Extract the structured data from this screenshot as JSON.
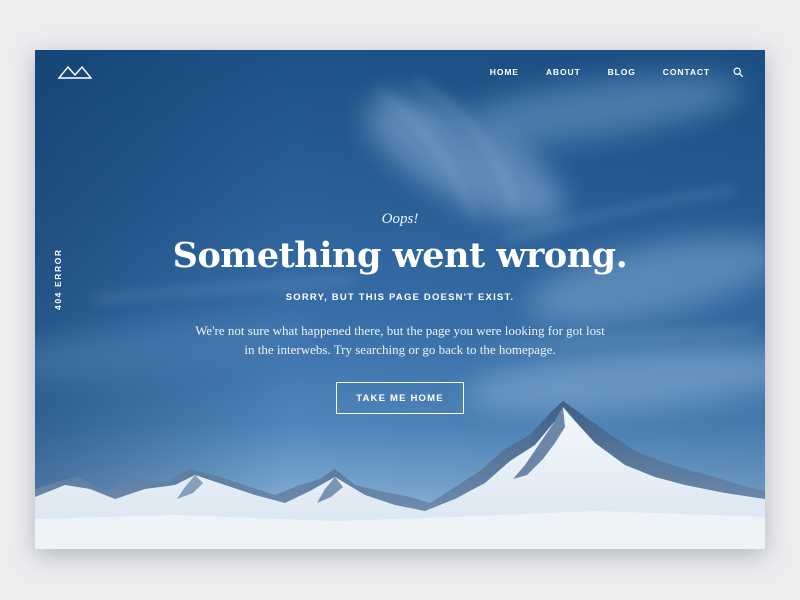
{
  "nav": {
    "items": [
      {
        "label": "HOME"
      },
      {
        "label": "ABOUT"
      },
      {
        "label": "BLOG"
      },
      {
        "label": "CONTACT"
      }
    ],
    "search_icon": "search-icon",
    "logo_icon": "mountain-logo-icon"
  },
  "side_label": "404 ERROR",
  "hero": {
    "eyebrow": "Oops!",
    "title": "Something went wrong.",
    "subtitle": "SORRY, BUT THIS PAGE DOESN'T EXIST.",
    "body": "We're not sure what happened there, but the page you were looking for got lost in the interwebs. Try searching or go back to the homepage.",
    "cta_label": "TAKE ME HOME"
  },
  "colors": {
    "sky_top": "#1d5287",
    "sky_bottom": "#b9d0e6",
    "text": "#ffffff",
    "page_bg": "#ecedef"
  }
}
